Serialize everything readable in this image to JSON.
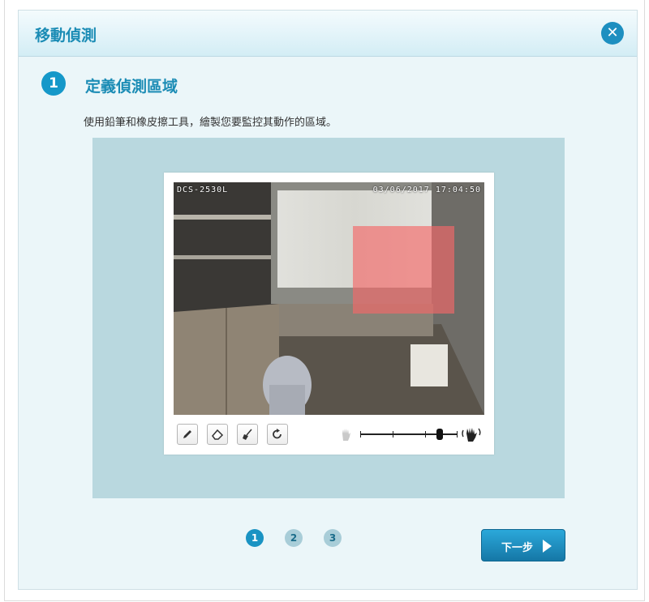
{
  "dialog": {
    "title": "移動偵測",
    "close_icon": "close-icon"
  },
  "step": {
    "number": "1",
    "title": "定義偵測區域",
    "description": "使用鉛筆和橡皮擦工具，繪製您要監控其動作的區域。"
  },
  "camera": {
    "model_label": "DCS-2530L",
    "timestamp": "03/06/2017 17:04:50"
  },
  "tools": [
    {
      "name": "pencil-tool-button",
      "icon": "pencil-icon"
    },
    {
      "name": "eraser-tool-button",
      "icon": "eraser-icon"
    },
    {
      "name": "clear-tool-button",
      "icon": "broom-icon"
    },
    {
      "name": "reset-tool-button",
      "icon": "refresh-icon"
    }
  ],
  "sensitivity": {
    "low_icon": "hand-still-icon",
    "high_icon": "hand-wave-icon",
    "value_fraction": 0.83
  },
  "pagination": {
    "pages": [
      "1",
      "2",
      "3"
    ],
    "active": "1"
  },
  "next_button": {
    "label": "下一步"
  },
  "colors": {
    "accent": "#1b8cb5",
    "panel_bg": "#ebf6f9",
    "stage_bg": "#b9d8df",
    "motion_region": "#f56969"
  }
}
